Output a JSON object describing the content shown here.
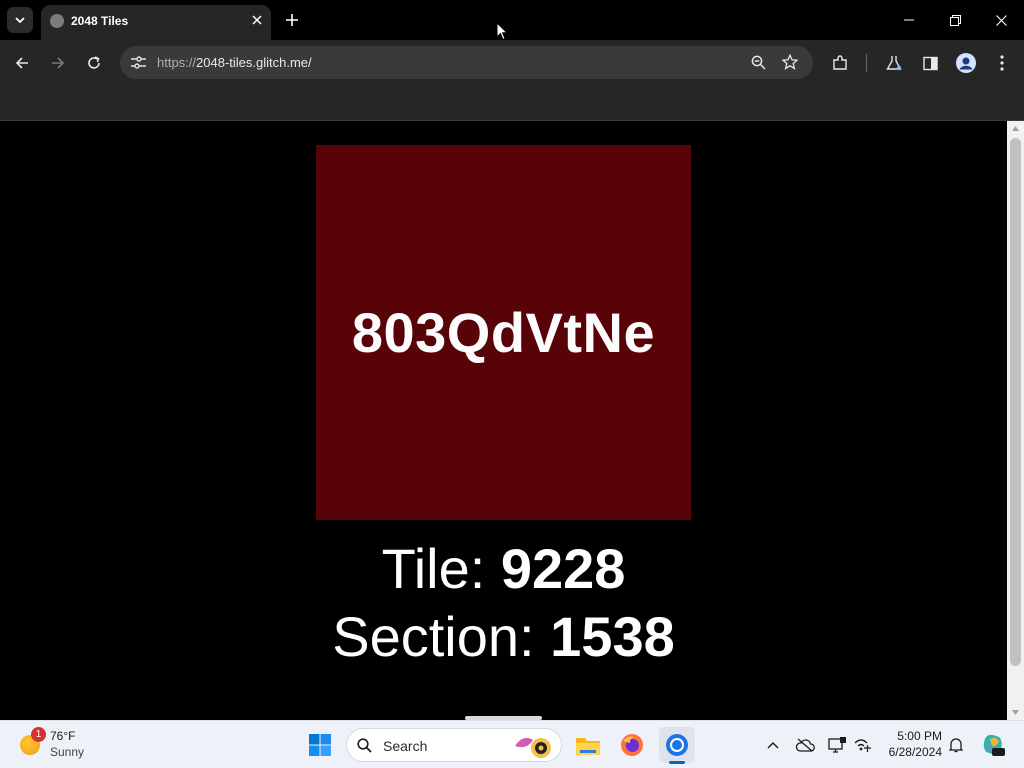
{
  "browser": {
    "tab_title": "2048 Tiles",
    "url_scheme": "https://",
    "url_rest": "2048-tiles.glitch.me/"
  },
  "page": {
    "tile_code": "803QdVtNe",
    "tile_label": "Tile: ",
    "tile_value": "9228",
    "section_label": "Section: ",
    "section_value": "1538",
    "tile_color": "#570307"
  },
  "taskbar": {
    "weather_temp": "76°F",
    "weather_condition": "Sunny",
    "weather_badge": "1",
    "search_label": "Search",
    "time": "5:00 PM",
    "date": "6/28/2024"
  },
  "icons": [
    "tab-list-icon",
    "globe-icon",
    "close-icon",
    "plus-icon",
    "minimize-icon",
    "restore-icon",
    "back-icon",
    "forward-icon",
    "reload-icon",
    "site-settings-icon",
    "zoom-icon",
    "star-icon",
    "extensions-icon",
    "labs-icon",
    "side-panel-icon",
    "profile-icon",
    "menu-icon",
    "windows-start-icon",
    "search-icon",
    "file-explorer-icon",
    "firefox-icon",
    "chrome-icon",
    "chevron-up-icon",
    "onedrive-icon",
    "display-icon",
    "network-icon",
    "bell-icon",
    "copilot-icon"
  ]
}
